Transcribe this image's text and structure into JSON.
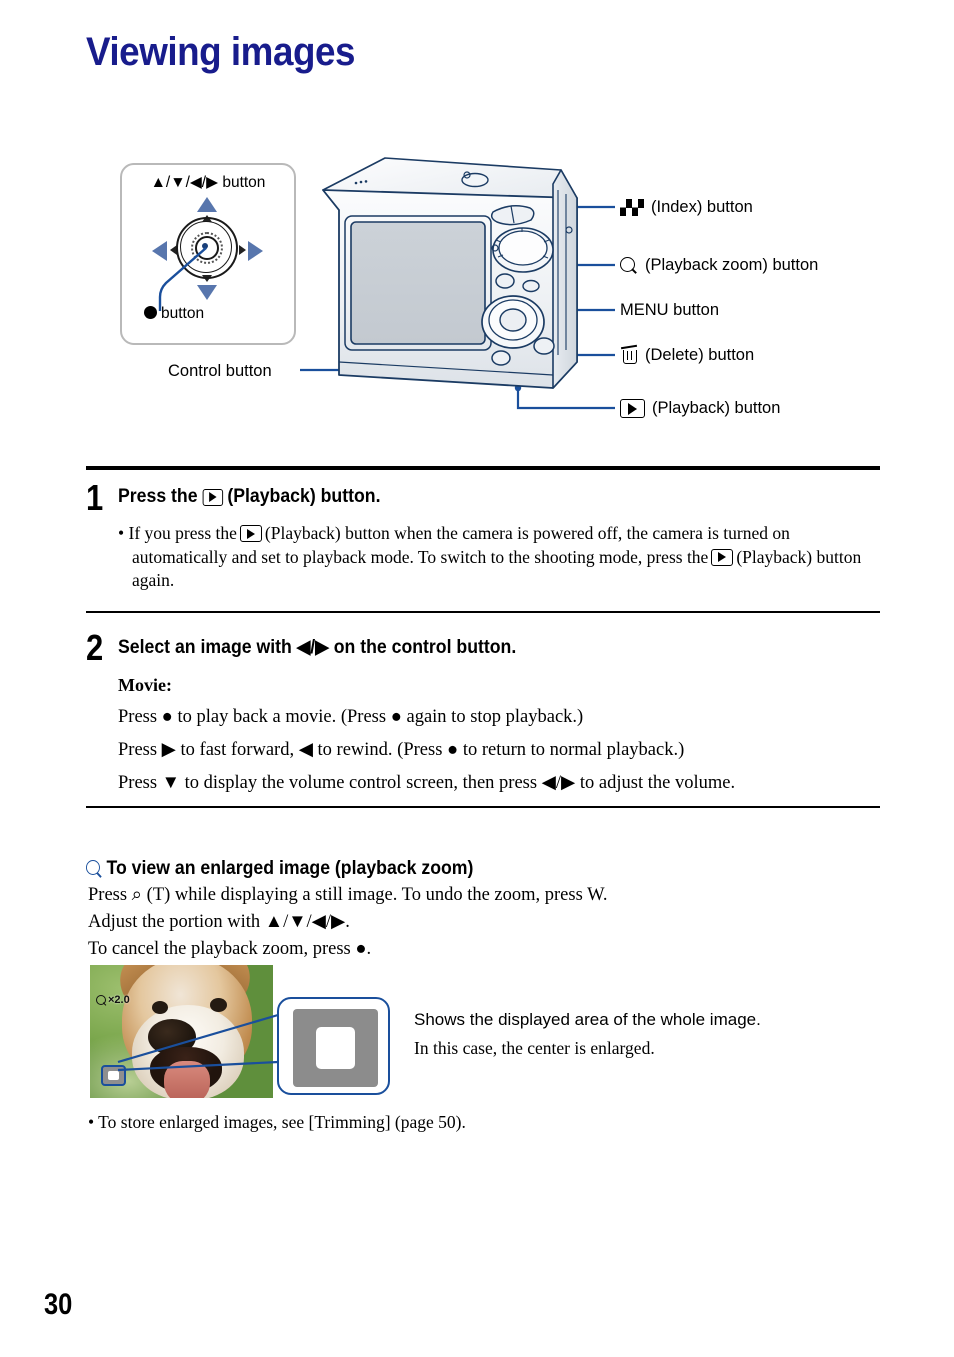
{
  "document": {
    "title": "Viewing images",
    "title_color": "#181c8c",
    "page_number": "30"
  },
  "figure": {
    "control_button_inset": {
      "top_label": "▲/▼/◀/▶ button",
      "bottom_label": "button",
      "bottom_label_icon": "filled-circle-icon"
    },
    "control_button_caption": "Control button",
    "camera_illustration": "camera-rear-line-drawing",
    "callouts": [
      {
        "icon": "index-checkerboard-icon",
        "label": "(Index) button"
      },
      {
        "icon": "magnifier-icon",
        "label": "(Playback zoom) button"
      },
      {
        "icon": "",
        "label": "MENU button"
      },
      {
        "icon": "trash-icon",
        "label": "(Delete) button"
      },
      {
        "icon": "playback-triangle-icon",
        "label": "(Playback) button"
      }
    ]
  },
  "steps": [
    {
      "number": "1",
      "heading_before": "Press the",
      "heading_icon": "playback-triangle-icon",
      "heading_after": "(Playback) button.",
      "bullet_part1": "If you press the",
      "bullet_part2": "(Playback) button when the camera is powered off, the camera is turned on automatically and set to playback mode. To switch to the shooting mode, press the",
      "bullet_part3": "(Playback) button again."
    },
    {
      "number": "2",
      "heading": "Select an image with ◀/▶ on the control button.",
      "movie_title": "Movie:",
      "movie_lines": [
        "Press ● to play back a movie. (Press ● again to stop playback.)",
        "Press ▶ to fast forward, ◀ to rewind. (Press ● to return to normal playback.)",
        "Press ▼ to display the volume control screen, then press ◀/▶ to adjust the volume."
      ]
    }
  ],
  "enlarged_section": {
    "heading_icon": "magnifier-icon",
    "heading_icon_color": "#1a4f9c",
    "heading": "To view an enlarged image (playback zoom)",
    "lines": [
      "Press ⌕ (T) while displaying a still image. To undo the zoom, press W.",
      "Adjust the portion with ▲/▼/◀/▶.",
      "To cancel the playback zoom, press ●."
    ],
    "photo": {
      "alt": "dog-photo",
      "zoom_indicator": "×2.0",
      "position_indicator": "display-area-indicator"
    },
    "magnified_callout": "display-area-indicator-enlarged",
    "caption_sans": "Shows the displayed area of the whole image.",
    "caption_serif": "In this case, the center is enlarged.",
    "note": "• To store enlarged images, see [Trimming] (page 50)."
  }
}
